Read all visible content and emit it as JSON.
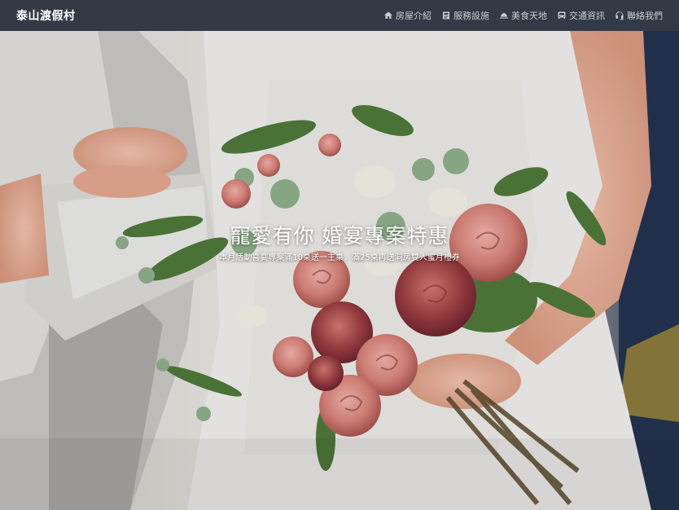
{
  "brand": {
    "name": "泰山渡假村"
  },
  "nav": [
    {
      "label": "房屋介紹",
      "icon": "house-icon"
    },
    {
      "label": "服務設施",
      "icon": "id-card-icon"
    },
    {
      "label": "美食天地",
      "icon": "dish-icon"
    },
    {
      "label": "交通資訊",
      "icon": "bus-icon"
    },
    {
      "label": "聯絡我們",
      "icon": "headset-icon"
    }
  ],
  "hero": {
    "title": "寵愛有你 婚宴專案特惠",
    "subtitle": "本月活動喜宴專案滿10桌送一主桌，滿25桌再送洞房雙人蜜月禮券"
  },
  "colors": {
    "navbar": "#343a45",
    "brand_text": "#ffffff",
    "nav_text": "#c9cdd4"
  }
}
